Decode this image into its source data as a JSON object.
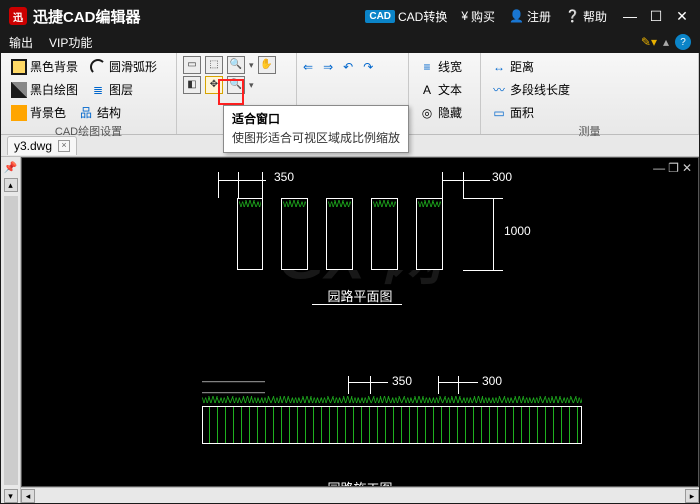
{
  "app": {
    "title": "迅捷CAD编辑器",
    "menu": {
      "convert": "CAD转换",
      "buy": "购买",
      "register": "注册",
      "help": "帮助"
    }
  },
  "menubar": {
    "output": "输出",
    "vip": "VIP功能"
  },
  "ribbon": {
    "group1": {
      "label": "CAD绘图设置",
      "black_bg": "黑色背景",
      "smooth_arc": "圆滑弧形",
      "bw_draw": "黑白绘图",
      "layer": "图层",
      "bg_color": "背景色",
      "structure": "结构"
    },
    "group2": {
      "label": ""
    },
    "group3": {
      "label": "测量",
      "linewidth": "线宽",
      "text": "文本",
      "hide": "隐藏",
      "measure_len": "测量",
      "distance": "距离",
      "polyline_len": "多段线长度",
      "area": "面积"
    }
  },
  "tooltip": {
    "title": "适合窗口",
    "desc": "使图形适合可视区域成比例缩放"
  },
  "tabs": {
    "doc1": "y3.dwg"
  },
  "drawing": {
    "dim350": "350",
    "dim300": "300",
    "dim1000": "1000",
    "title1": "园路平面图",
    "title2": "园路施工图",
    "watermark": "GX  网"
  }
}
